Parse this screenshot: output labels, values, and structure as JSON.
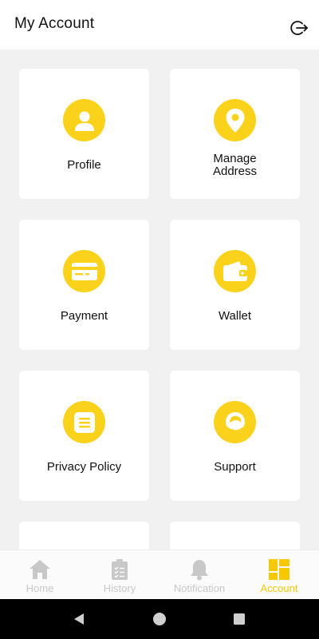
{
  "header": {
    "title": "My Account",
    "logout_icon": "logout-icon"
  },
  "cards": [
    {
      "label": "Profile",
      "icon": "person-icon"
    },
    {
      "label": "Manage\nAddress",
      "icon": "location-pin-icon"
    },
    {
      "label": "Payment",
      "icon": "credit-card-icon"
    },
    {
      "label": "Wallet",
      "icon": "wallet-icon"
    },
    {
      "label": "Privacy Policy",
      "icon": "document-icon"
    },
    {
      "label": "Support",
      "icon": "headset-icon"
    }
  ],
  "tabs": [
    {
      "label": "Home",
      "icon": "home-icon",
      "active": false
    },
    {
      "label": "History",
      "icon": "clipboard-icon",
      "active": false
    },
    {
      "label": "Notification",
      "icon": "bell-icon",
      "active": false
    },
    {
      "label": "Account",
      "icon": "grid-icon",
      "active": true
    }
  ],
  "colors": {
    "accent": "#fbd21b",
    "active_tab": "#f5c800",
    "inactive_tab": "#c8c8c8"
  }
}
